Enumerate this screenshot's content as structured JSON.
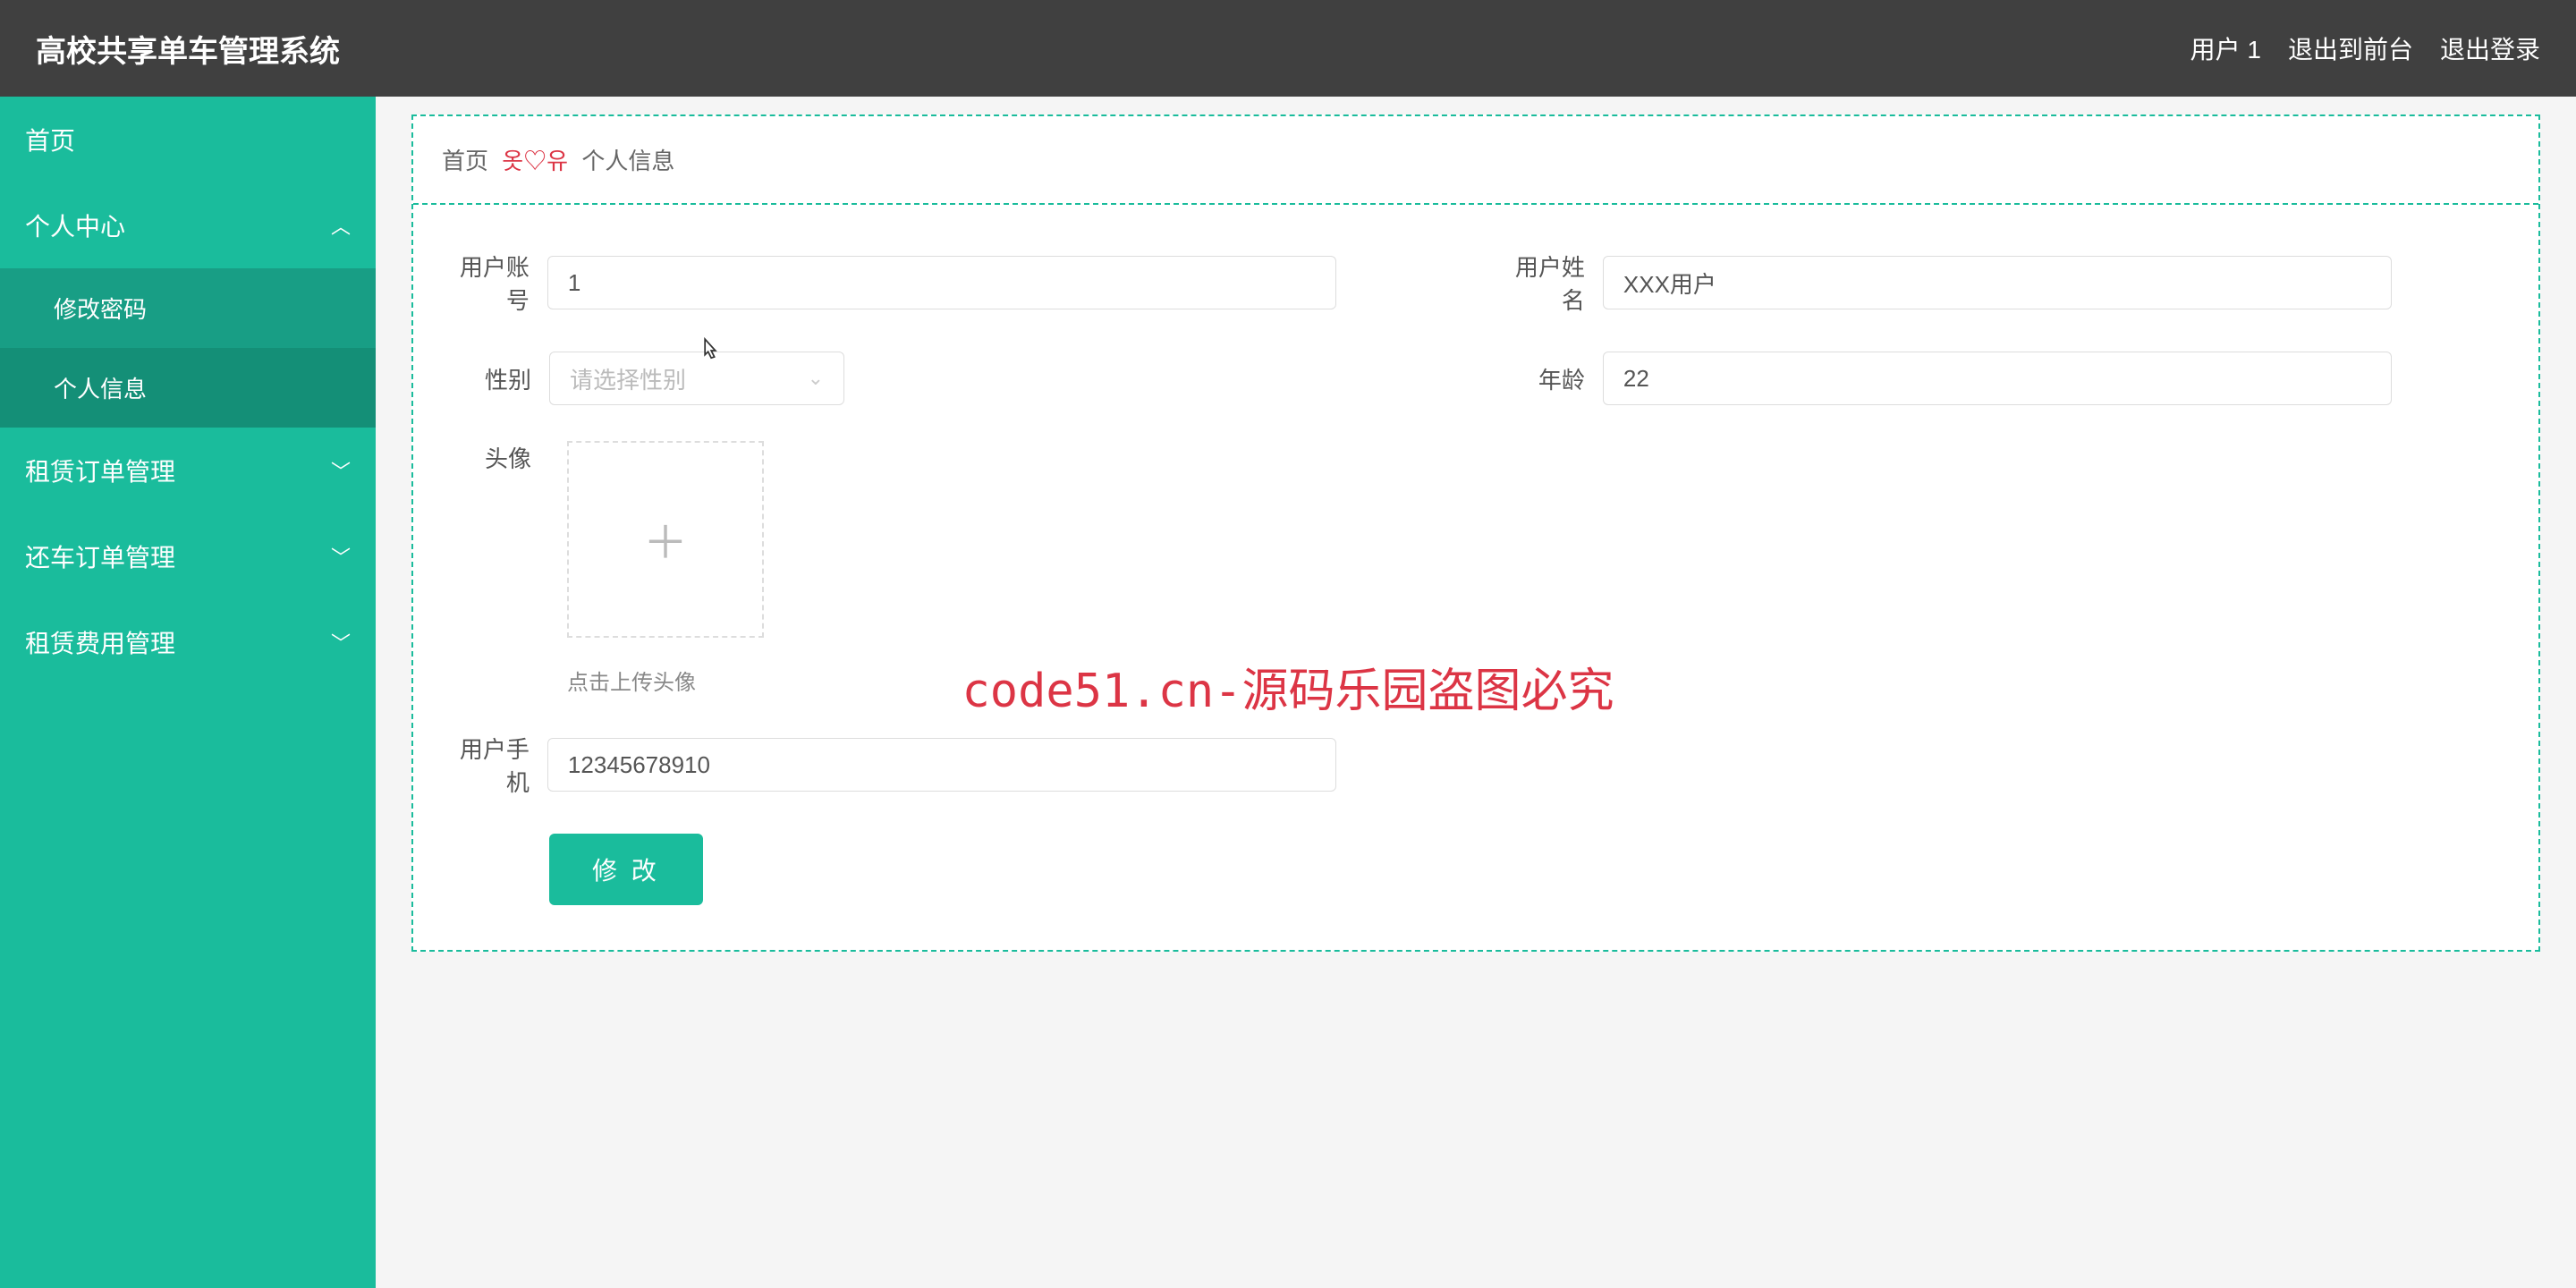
{
  "header": {
    "title": "高校共享单车管理系统",
    "user_label": "用户 1",
    "exit_front": "退出到前台",
    "logout": "退出登录"
  },
  "sidebar": {
    "home": "首页",
    "personal_center": "个人中心",
    "change_password": "修改密码",
    "personal_info": "个人信息",
    "rental_orders": "租赁订单管理",
    "return_orders": "还车订单管理",
    "rental_fees": "租赁费用管理"
  },
  "breadcrumb": {
    "home": "首页",
    "sep": "옷♡유",
    "current": "个人信息"
  },
  "form": {
    "account_label": "用户账号",
    "account_value": "1",
    "name_label": "用户姓名",
    "name_value": "XXX用户",
    "gender_label": "性别",
    "gender_placeholder": "请选择性别",
    "age_label": "年龄",
    "age_value": "22",
    "avatar_label": "头像",
    "avatar_hint": "点击上传头像",
    "phone_label": "用户手机",
    "phone_value": "12345678910",
    "submit_label": "修 改"
  },
  "watermark": {
    "text": "code51.cn",
    "center": "code51.cn-源码乐园盗图必究"
  }
}
